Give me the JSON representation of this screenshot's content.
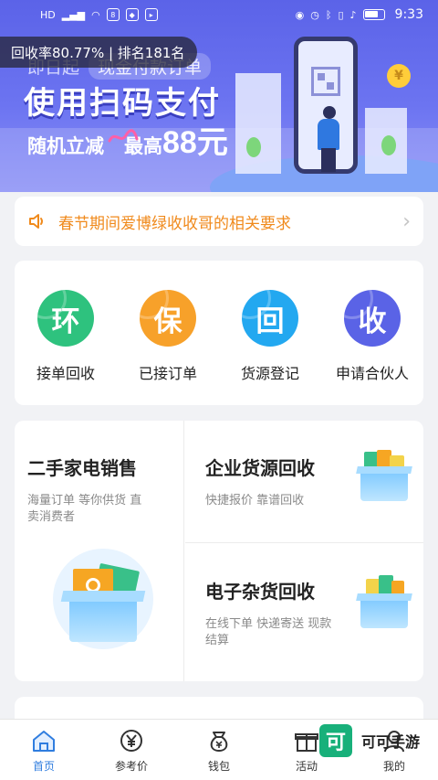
{
  "status_bar": {
    "left_icons": [
      "hd-icon",
      "5g-signal-icon",
      "wifi-icon",
      "app-icon",
      "shield-icon",
      "send-icon"
    ],
    "network_label": "HD",
    "time": "9:33"
  },
  "banner": {
    "rank_text": "回收率80.77% | 排名181名",
    "subtitle_left": "即日起",
    "subtitle_tag": "现金付款订单",
    "title": "使用扫码支付",
    "line3_left": "随机立减",
    "line3_right_prefix": "最高",
    "line3_amount": "88元"
  },
  "notice": {
    "text": "春节期间爱博绿收收哥的相关要求"
  },
  "quick_actions": [
    {
      "glyph": "环",
      "label": "接单回收",
      "color": "#2ec27e"
    },
    {
      "glyph": "保",
      "label": "已接订单",
      "color": "#f7a12a"
    },
    {
      "glyph": "回",
      "label": "货源登记",
      "color": "#23a8f0"
    },
    {
      "glyph": "收",
      "label": "申请合伙人",
      "color": "#5a63e6"
    }
  ],
  "cards": {
    "left": {
      "title": "二手家电销售",
      "desc": "海量订单  等你供货 直卖消费者"
    },
    "right_top": {
      "title": "企业货源回收",
      "desc": "快捷报价  靠谱回收"
    },
    "right_bottom": {
      "title": "电子杂货回收",
      "desc": "在线下单  快递寄送  现款结算"
    }
  },
  "tabbar": [
    {
      "label": "首页",
      "icon": "home-icon",
      "active": true
    },
    {
      "label": "参考价",
      "icon": "yuan-icon",
      "active": false
    },
    {
      "label": "钱包",
      "icon": "wallet-icon",
      "active": false
    },
    {
      "label": "活动",
      "icon": "gift-icon",
      "active": false
    },
    {
      "label": "我的",
      "icon": "user-icon",
      "active": false
    }
  ],
  "watermark": {
    "logo": "可",
    "text": "可可手游"
  },
  "colors": {
    "accent": "#2f7ddf",
    "banner": "#5b63e8",
    "notice": "#f08a1c"
  }
}
